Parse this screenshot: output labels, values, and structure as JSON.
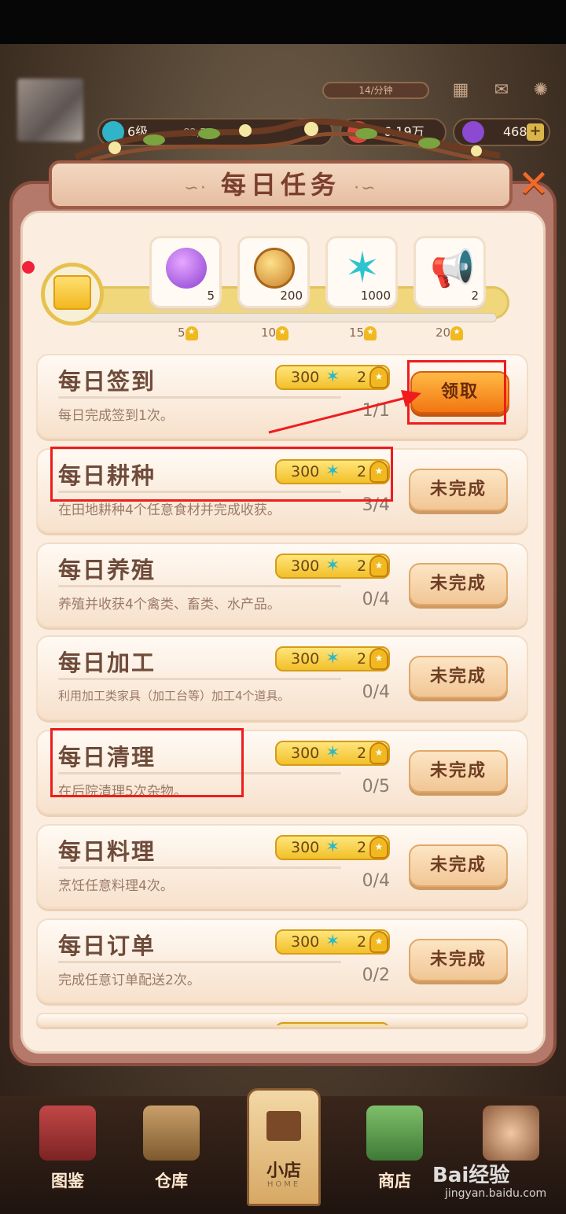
{
  "hud": {
    "energy_text": "14/分钟",
    "level": "6级",
    "level_progress": "82,57",
    "money": "6.19万",
    "gems": "468",
    "plus_label": "+"
  },
  "panel": {
    "title": "每日任务",
    "title_deco_left": "∽·",
    "title_deco_right": "·∽",
    "close_label": "✕"
  },
  "rewards": [
    {
      "icon": "purple-gem-icon",
      "count": "5",
      "milestone": "5"
    },
    {
      "icon": "gold-coin-icon",
      "count": "200",
      "milestone": "10"
    },
    {
      "icon": "teal-star-icon",
      "count": "1000",
      "milestone": "15"
    },
    {
      "icon": "megaphone-icon",
      "count": "2",
      "milestone": "20"
    }
  ],
  "tasks": [
    {
      "title": "每日签到",
      "desc": "每日完成签到1次。",
      "reward_value": "300",
      "reward_medals": "2",
      "progress": "1/1",
      "button": "领取",
      "state": "claim"
    },
    {
      "title": "每日耕种",
      "desc": "在田地耕种4个任意食材并完成收获。",
      "reward_value": "300",
      "reward_medals": "2",
      "progress": "3/4",
      "button": "未完成",
      "state": "incomplete"
    },
    {
      "title": "每日养殖",
      "desc": "养殖并收获4个禽类、畜类、水产品。",
      "reward_value": "300",
      "reward_medals": "2",
      "progress": "0/4",
      "button": "未完成",
      "state": "incomplete"
    },
    {
      "title": "每日加工",
      "desc": "利用加工类家具（加工台等）加工4个道具。",
      "reward_value": "300",
      "reward_medals": "2",
      "progress": "0/4",
      "button": "未完成",
      "state": "incomplete"
    },
    {
      "title": "每日清理",
      "desc": "在后院清理5次杂物。",
      "reward_value": "300",
      "reward_medals": "2",
      "progress": "0/5",
      "button": "未完成",
      "state": "incomplete"
    },
    {
      "title": "每日料理",
      "desc": "烹饪任意料理4次。",
      "reward_value": "300",
      "reward_medals": "2",
      "progress": "0/4",
      "button": "未完成",
      "state": "incomplete"
    },
    {
      "title": "每日订单",
      "desc": "完成任意订单配送2次。",
      "reward_value": "300",
      "reward_medals": "2",
      "progress": "0/2",
      "button": "未完成",
      "state": "incomplete"
    }
  ],
  "nav": {
    "items": [
      {
        "label": "图鉴"
      },
      {
        "label": "仓库"
      },
      {
        "label": "小店"
      },
      {
        "label": "商店"
      }
    ],
    "home_sub": "HOME"
  },
  "watermark": {
    "brand": "Bai经验",
    "url": "jingyan.baidu.com"
  },
  "colors": {
    "accent_orange": "#f27613",
    "highlight_red": "#f01c1c",
    "panel_bg": "#fbeee0"
  }
}
